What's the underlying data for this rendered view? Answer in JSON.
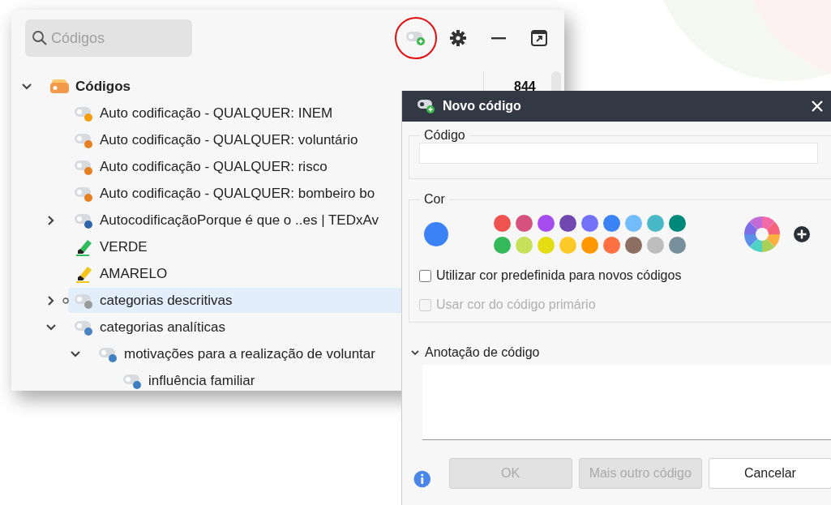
{
  "toolbar": {
    "search": {
      "placeholder": "Códigos"
    },
    "new_code_highlighted": true
  },
  "tree": {
    "items": [
      {
        "label": "Códigos",
        "kind": "root",
        "count": "844",
        "expanded": true,
        "selected": false,
        "children": [
          {
            "label": "Auto codificação - QUALQUER: INEM",
            "kind": "code",
            "color": "#f59e0b",
            "selected": false
          },
          {
            "label": "Auto codificação - QUALQUER: voluntário",
            "kind": "code",
            "color": "#e67e22",
            "selected": false
          },
          {
            "label": "Auto codificação - QUALQUER: risco",
            "kind": "code",
            "color": "#e67e22",
            "selected": false
          },
          {
            "label": "Auto codificação - QUALQUER: bombeiro bo",
            "kind": "code",
            "color": "#e67e22",
            "selected": false
          },
          {
            "label": "AutocodificaçãoPorque é que o ..es | TEDxAv",
            "kind": "code",
            "color": "#2e64a8",
            "expanded": false,
            "selected": false
          },
          {
            "label": "VERDE",
            "kind": "marker",
            "color": "#2ebd59",
            "selected": false
          },
          {
            "label": "AMARELO",
            "kind": "marker",
            "color": "#f5c518",
            "selected": false
          },
          {
            "label": "categorias descritivas",
            "kind": "code",
            "color": "#9a9a9a",
            "expanded": false,
            "selected": true
          },
          {
            "label": "categorias analíticas",
            "kind": "code",
            "color": "#4a84c0",
            "expanded": true,
            "selected": false,
            "children": [
              {
                "label": "motivações para a realização de voluntar",
                "kind": "code",
                "color": "#3f7fbf",
                "expanded": true,
                "selected": false,
                "children": [
                  {
                    "label": "influência familiar",
                    "kind": "code",
                    "color": "#3f7fbf",
                    "selected": false
                  }
                ]
              }
            ]
          }
        ]
      }
    ]
  },
  "dialog": {
    "title": "Novo código",
    "code_section": {
      "label": "Código"
    },
    "color_section": {
      "label": "Cor",
      "current": {
        "color": "#3b82f6"
      },
      "palette": [
        {
          "color": "#ef5350"
        },
        {
          "color": "#d6517d"
        },
        {
          "color": "#a64def"
        },
        {
          "color": "#7048b0"
        },
        {
          "color": "#7272f7"
        },
        {
          "color": "#3b82f6"
        },
        {
          "color": "#72bcfc"
        },
        {
          "color": "#49b9ca"
        },
        {
          "color": "#00897b"
        },
        {
          "color": "#33b85a"
        },
        {
          "color": "#c6e05a"
        },
        {
          "color": "#e5dd14"
        },
        {
          "color": "#ffc928"
        },
        {
          "color": "#ff9800"
        },
        {
          "color": "#ff7043"
        },
        {
          "color": "#8d6e63"
        },
        {
          "color": "#bdbdbd"
        },
        {
          "color": "#78909c"
        }
      ],
      "options": [
        {
          "label": "Utilizar cor predefinida para novos códigos",
          "checked": false,
          "disabled": false
        },
        {
          "label": "Usar cor do código primário",
          "checked": false,
          "disabled": true
        }
      ]
    },
    "annotation": {
      "label": "Anotação de código",
      "expanded": true
    },
    "buttons": [
      {
        "label": "OK",
        "disabled": true
      },
      {
        "label": "Mais outro código",
        "disabled": true
      },
      {
        "label": "Cancelar",
        "disabled": false
      }
    ]
  }
}
